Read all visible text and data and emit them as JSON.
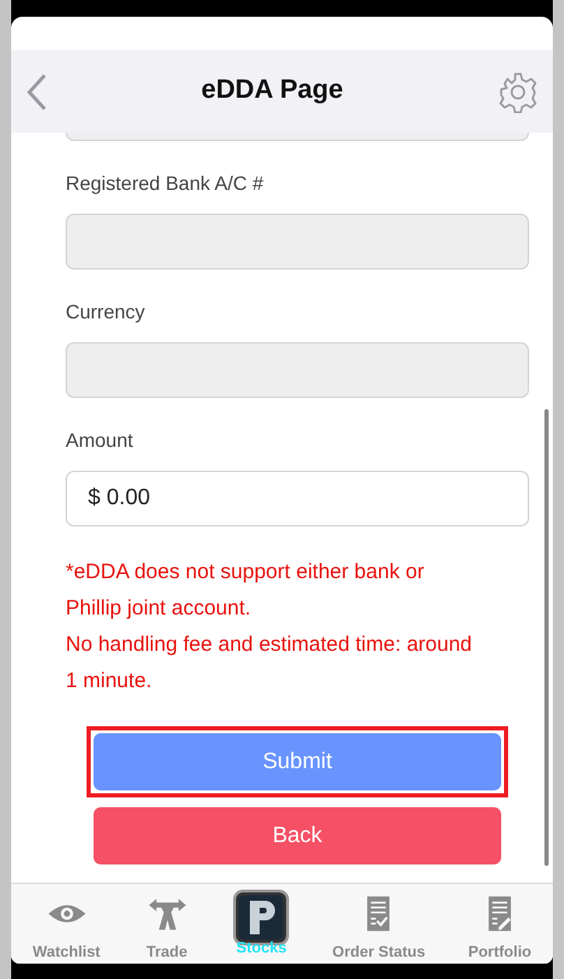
{
  "header": {
    "title": "eDDA Page"
  },
  "fields": [
    {
      "kind": "clipped",
      "disabled": true
    },
    {
      "kind": "text",
      "label": "Registered Bank A/C #",
      "disabled": true
    },
    {
      "kind": "text",
      "label": "Currency",
      "disabled": true
    },
    {
      "kind": "text",
      "label": "Amount",
      "value": "$ 0.00",
      "disabled": false
    }
  ],
  "notes": [
    "*eDDA does not support either bank or Phillip joint account.",
    "No handling fee and estimated time: around 1 minute."
  ],
  "buttons": [
    {
      "kind": "primary",
      "label": "Submit",
      "highlighted": true
    },
    {
      "kind": "danger",
      "label": "Back",
      "highlighted": false
    }
  ],
  "tabs": [
    {
      "kind": "eye",
      "label": "Watchlist",
      "selected": false
    },
    {
      "kind": "trade",
      "label": "Trade",
      "selected": false
    },
    {
      "kind": "logo",
      "label": "Stocks",
      "selected": true
    },
    {
      "kind": "check-doc",
      "label": "Order Status",
      "selected": false
    },
    {
      "kind": "edit-doc",
      "label": "Portfolio",
      "selected": false
    }
  ]
}
